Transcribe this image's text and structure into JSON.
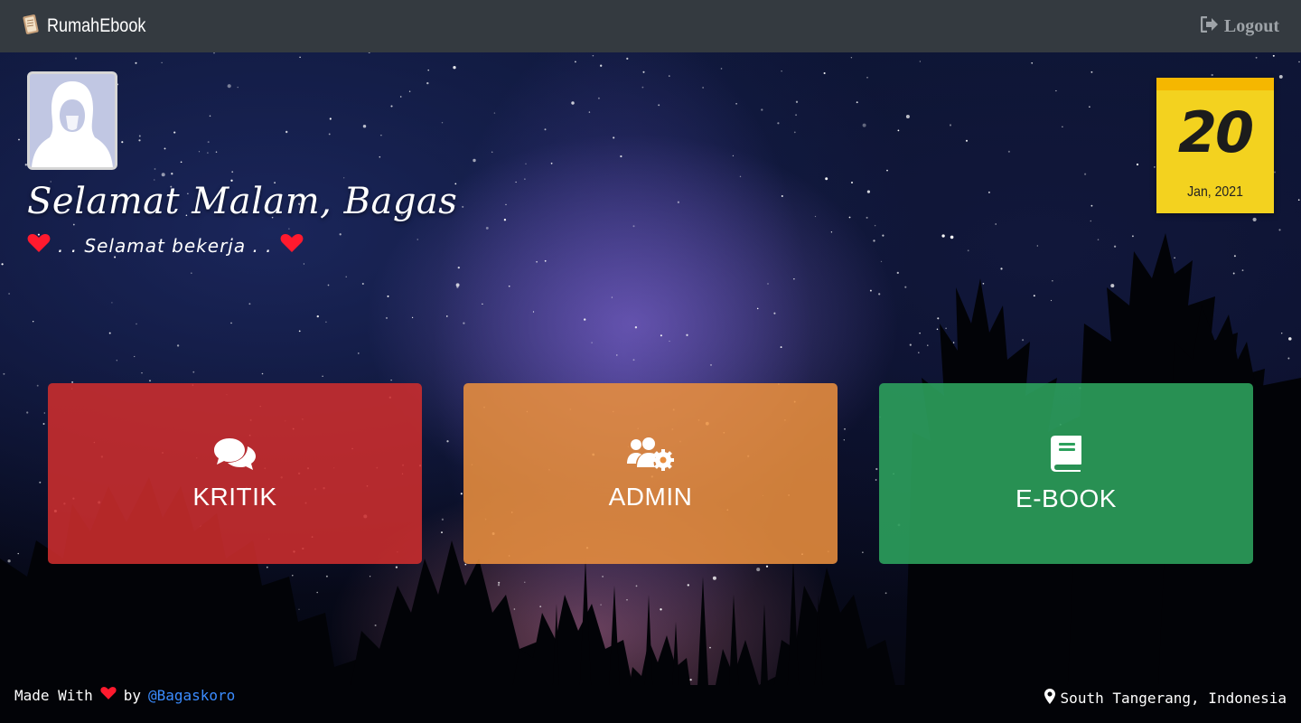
{
  "navbar": {
    "brand": "RumahEbook",
    "brand_icon": "book-scroll-icon",
    "logout_label": "Logout",
    "logout_icon": "sign-out-icon",
    "background_color": "#343a40"
  },
  "profile": {
    "greeting": "Selamat Malam, Bagas",
    "subtitle": ". . Selamat bekerja . .",
    "heart_color": "#ff1a2e"
  },
  "calendar": {
    "day": "20",
    "month_year": "Jan, 2021",
    "color": "#f3d21f"
  },
  "cards": [
    {
      "label": "KRITIK",
      "icon": "comments-icon",
      "color": "#cd2d2d"
    },
    {
      "label": "ADMIN",
      "icon": "users-cog-icon",
      "color": "#e98e3e"
    },
    {
      "label": "E-BOOK",
      "icon": "book-icon",
      "color": "#2ca05c"
    }
  ],
  "footer": {
    "made_with": "Made With",
    "by": "by",
    "author": "@Bagaskoro",
    "location": "South Tangerang, Indonesia"
  }
}
